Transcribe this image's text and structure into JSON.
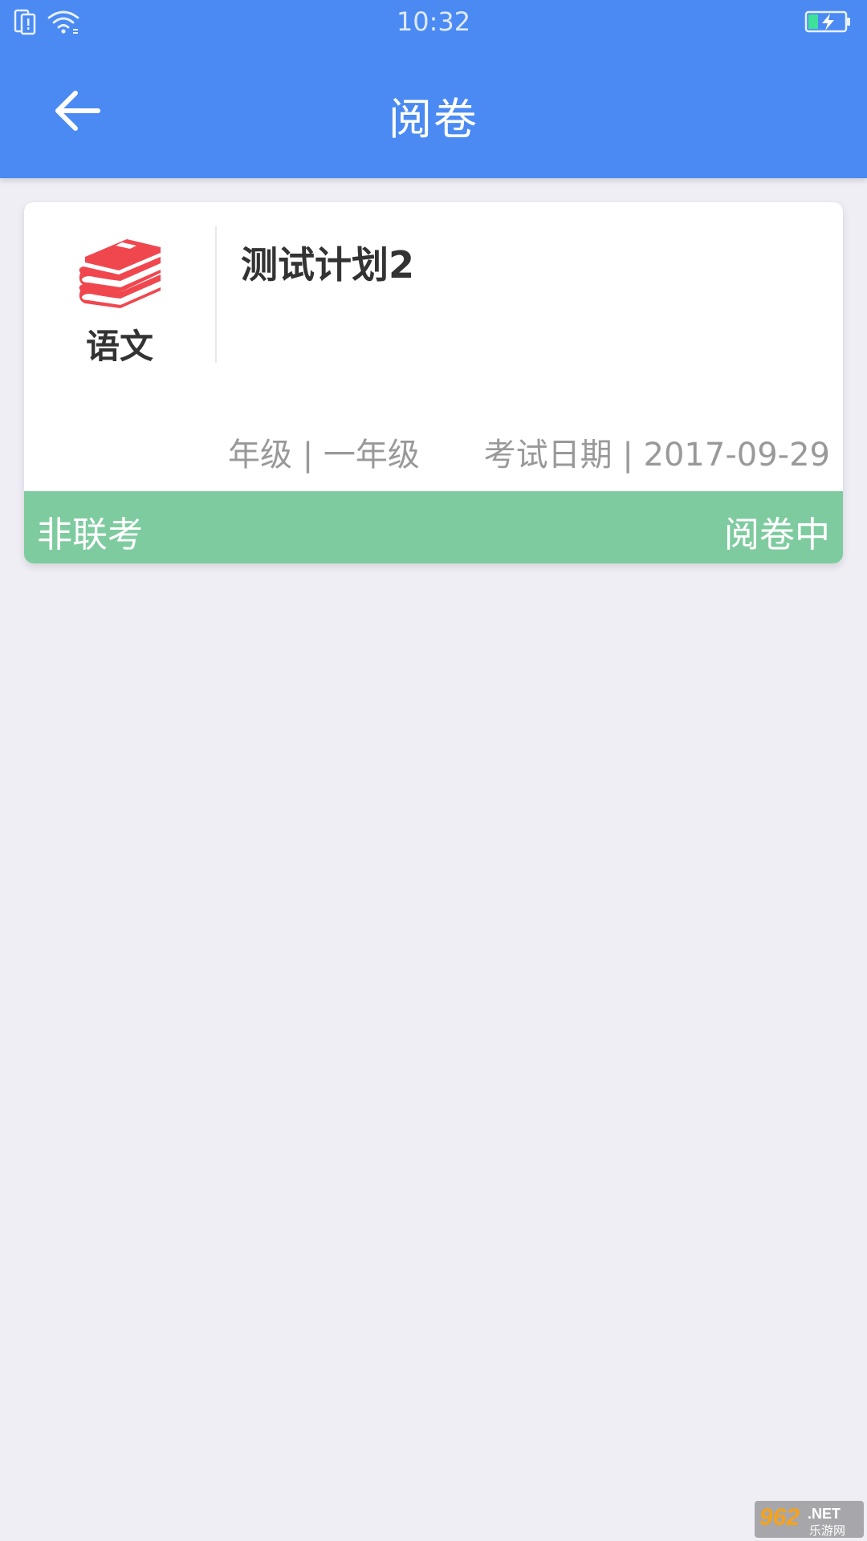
{
  "status_bar": {
    "time": "10:32",
    "icons": [
      "sim-icon",
      "wifi-icon",
      "battery-charging-icon"
    ],
    "color": "#4a8af2"
  },
  "app_bar": {
    "title": "阅卷",
    "back_icon": "arrow-left-icon",
    "color": "#4a8af2"
  },
  "cards": [
    {
      "subject": "语文",
      "subject_icon": "book-stack-icon",
      "icon_color": "#f0474f",
      "title": "测试计划2",
      "grade": "年级 | 一年级",
      "exam_date": "考试日期 | 2017-09-29",
      "exam_type": "非联考",
      "status": "阅卷中",
      "footer_color": "#7fcba0"
    }
  ],
  "watermark": {
    "number": "962",
    "suffix": ".NET",
    "site": "乐游网"
  }
}
